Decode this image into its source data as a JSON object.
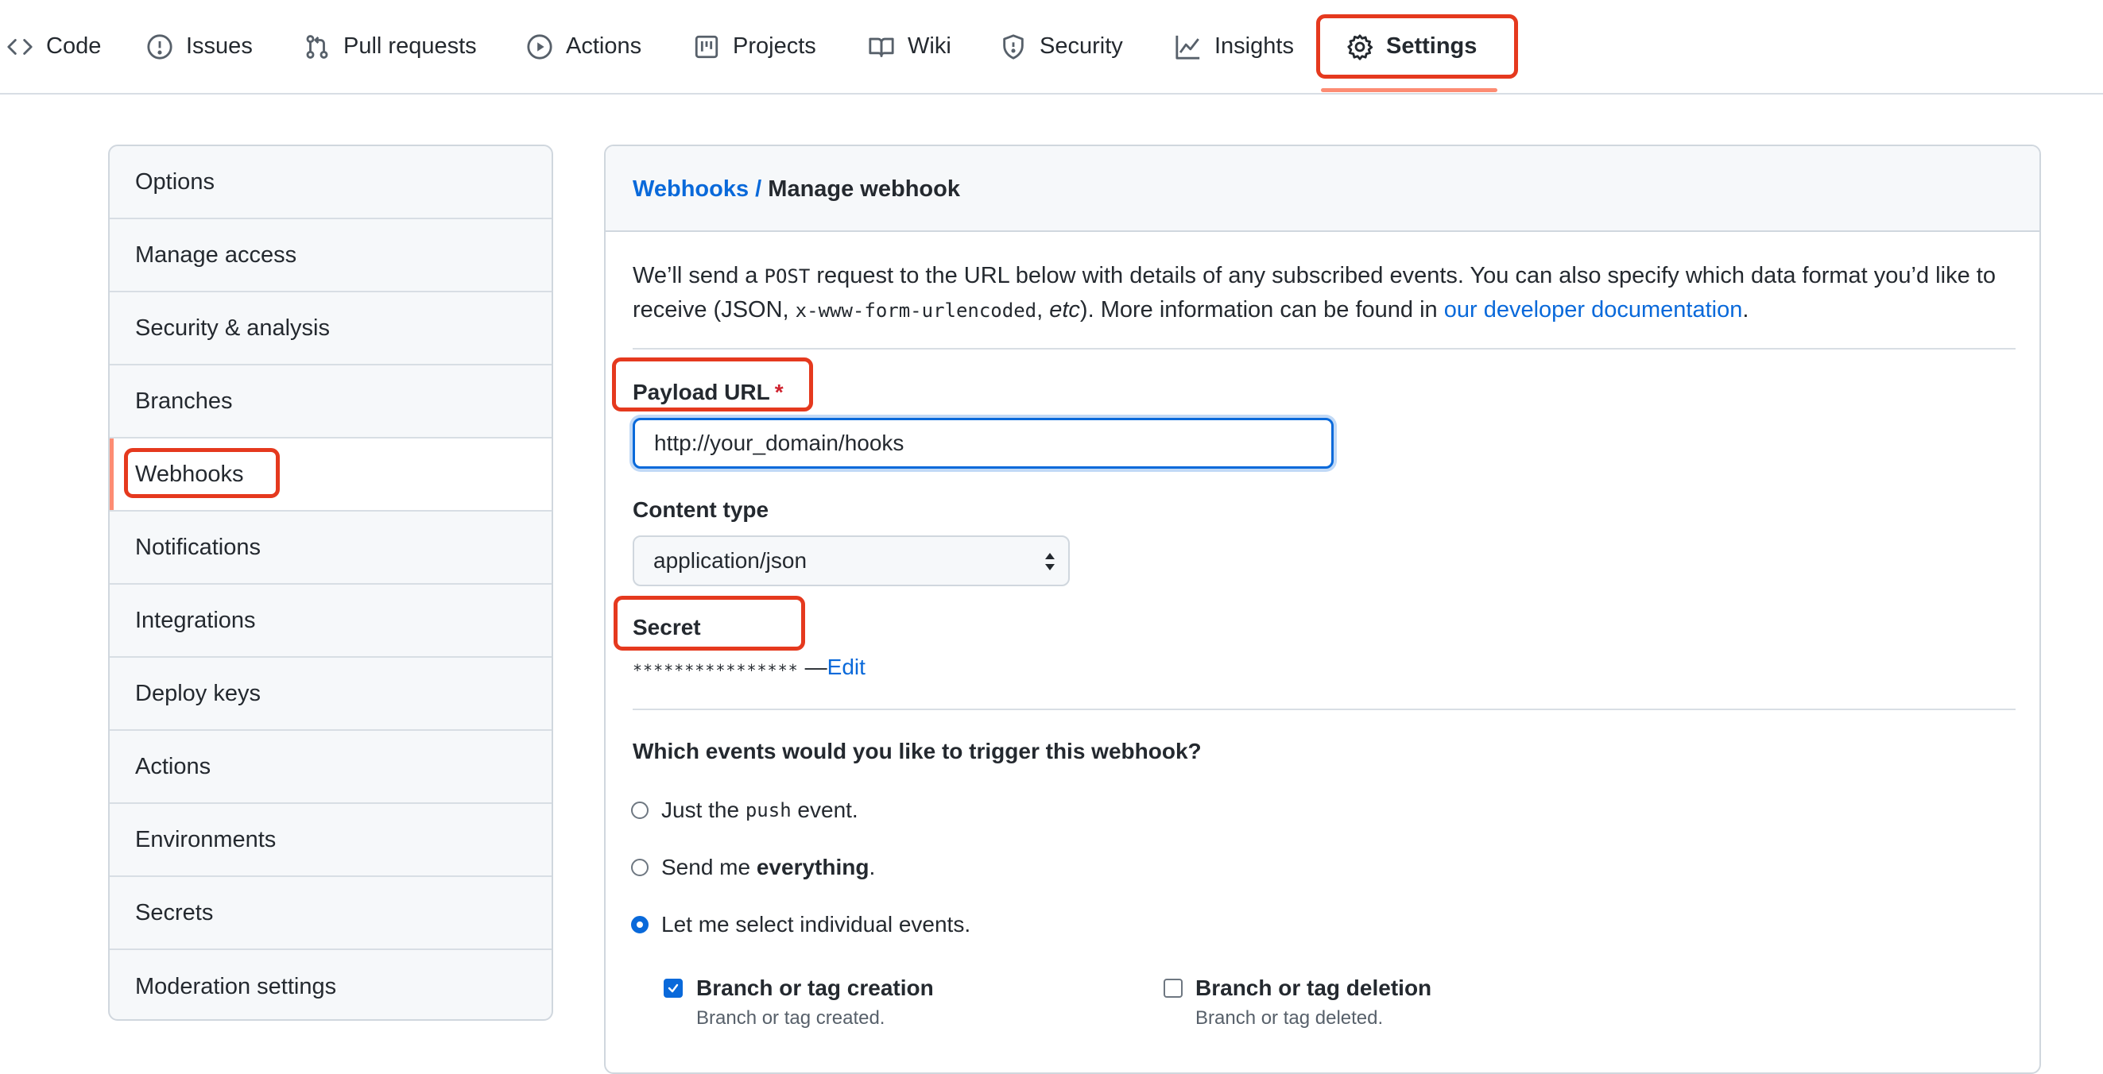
{
  "nav": {
    "tabs": [
      {
        "label": "Code",
        "icon": "code-icon"
      },
      {
        "label": "Issues",
        "icon": "issue-icon"
      },
      {
        "label": "Pull requests",
        "icon": "pull-request-icon"
      },
      {
        "label": "Actions",
        "icon": "play-icon"
      },
      {
        "label": "Projects",
        "icon": "project-icon"
      },
      {
        "label": "Wiki",
        "icon": "book-icon"
      },
      {
        "label": "Security",
        "icon": "shield-icon"
      },
      {
        "label": "Insights",
        "icon": "graph-icon"
      },
      {
        "label": "Settings",
        "icon": "gear-icon"
      }
    ],
    "selected": "Settings"
  },
  "sidebar": {
    "items": [
      {
        "label": "Options"
      },
      {
        "label": "Manage access"
      },
      {
        "label": "Security & analysis"
      },
      {
        "label": "Branches"
      },
      {
        "label": "Webhooks"
      },
      {
        "label": "Notifications"
      },
      {
        "label": "Integrations"
      },
      {
        "label": "Deploy keys"
      },
      {
        "label": "Actions"
      },
      {
        "label": "Environments"
      },
      {
        "label": "Secrets"
      },
      {
        "label": "Moderation settings"
      }
    ],
    "active": "Webhooks"
  },
  "main": {
    "breadcrumb": {
      "parent": "Webhooks",
      "separator": "/",
      "current": "Manage webhook"
    },
    "description": {
      "p1": "We’ll send a ",
      "code1": "POST",
      "p2": " request to the URL below with details of any subscribed events. You can also specify which data format you’d like to receive (JSON, ",
      "code2": "x-www-form-urlencoded",
      "p3": ", ",
      "etc": "etc",
      "p4": "). More information can be found in ",
      "link": "our developer documentation",
      "p5": "."
    },
    "payload_url": {
      "label": "Payload URL",
      "required_mark": "*",
      "value": "http://your_domain/hooks"
    },
    "content_type": {
      "label": "Content type",
      "value": "application/json"
    },
    "secret": {
      "label": "Secret",
      "masked": "****************",
      "dash": " — ",
      "edit_label": "Edit"
    },
    "events": {
      "question": "Which events would you like to trigger this webhook?",
      "options": [
        {
          "pre": "Just the ",
          "code": "push",
          "post": " event.",
          "selected": false
        },
        {
          "pre": "Send me ",
          "bold": "everything",
          "post": ".",
          "selected": false
        },
        {
          "pre": "Let me select individual events.",
          "selected": true
        }
      ],
      "individual": [
        {
          "title": "Branch or tag creation",
          "desc": "Branch or tag created.",
          "checked": true
        },
        {
          "title": "Branch or tag deletion",
          "desc": "Branch or tag deleted.",
          "checked": false
        }
      ]
    }
  },
  "colors": {
    "accent": "#0969da",
    "highlight": "#e5391e",
    "tab_underline": "#fd8c73"
  }
}
